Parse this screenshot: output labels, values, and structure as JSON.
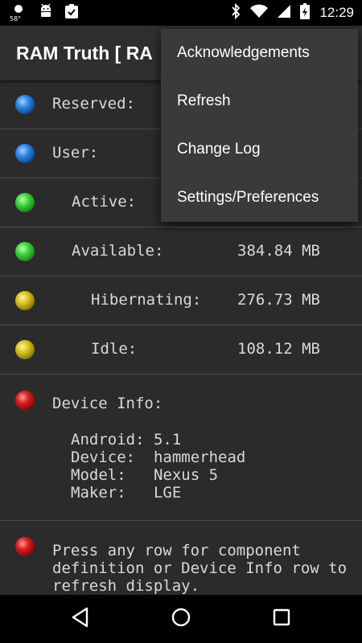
{
  "status_bar": {
    "temperature": "58°",
    "time": "12:29"
  },
  "app_bar": {
    "title": "RAM Truth    [ RA"
  },
  "rows": [
    {
      "label": "Reserved:",
      "value": "",
      "indent": 0,
      "color": "blue"
    },
    {
      "label": "User:",
      "value": "",
      "indent": 0,
      "color": "blue"
    },
    {
      "label": "Active:",
      "value": "",
      "indent": 1,
      "color": "green"
    },
    {
      "label": "Available:",
      "value": "384.84 MB",
      "indent": 1,
      "color": "green"
    },
    {
      "label": "Hibernating:",
      "value": "276.73 MB",
      "indent": 2,
      "color": "yellow"
    },
    {
      "label": "Idle:",
      "value": "108.12 MB",
      "indent": 2,
      "color": "yellow"
    }
  ],
  "device_info": {
    "title": "Device Info:",
    "lines": [
      "Android: 5.1",
      "Device:  hammerhead",
      "Model:   Nexus 5",
      "Maker:   LGE"
    ]
  },
  "help": {
    "text": "Press any row for component definition or Device Info row to refresh display."
  },
  "menu": {
    "items": [
      "Acknowledgements",
      "Refresh",
      "Change Log",
      "Settings/Preferences"
    ]
  },
  "colors": {
    "blue": "#2f86e0",
    "green": "#3ed53e",
    "yellow": "#d9c21c",
    "red": "#d81e1e"
  }
}
